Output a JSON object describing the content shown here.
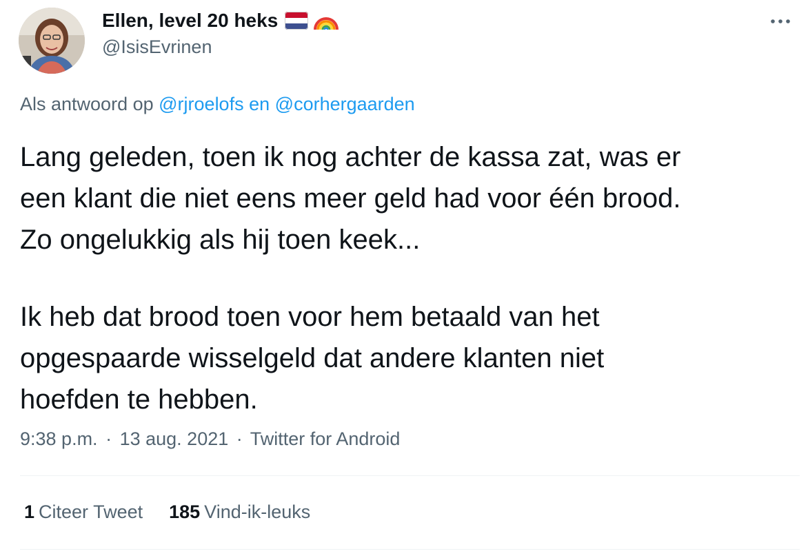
{
  "author": {
    "display_name": "Ellen, level 20 heks",
    "handle": "@IsisEvrinen",
    "avatar_icon": "profile-photo",
    "name_emojis": [
      "netherlands-flag-icon",
      "rainbow-icon"
    ]
  },
  "header": {
    "more_icon": "more-horizontal-icon"
  },
  "reply": {
    "prefix": "Als antwoord op",
    "mention_1": "@rjroelofs",
    "joiner": "en",
    "mention_2": "@corhergaarden"
  },
  "tweet": {
    "lines": [
      "Lang geleden, toen ik nog achter de kassa zat, was er",
      "een klant die niet eens meer geld had voor één brood.",
      "Zo ongelukkig als hij toen keek...",
      "",
      "Ik heb dat brood toen voor hem betaald van het",
      "opgespaarde wisselgeld dat andere klanten niet",
      "hoefden te hebben."
    ]
  },
  "meta": {
    "time": "9:38 p.m.",
    "date": "13 aug. 2021",
    "source": "Twitter for Android",
    "separator": "·"
  },
  "stats": {
    "quotes_count": "1",
    "quotes_label": "Citeer Tweet",
    "likes_count": "185",
    "likes_label": "Vind-ik-leuks"
  },
  "colors": {
    "text_primary": "#0f1419",
    "text_secondary": "#536471",
    "link": "#1d9bf0",
    "divider": "#eff3f4"
  }
}
